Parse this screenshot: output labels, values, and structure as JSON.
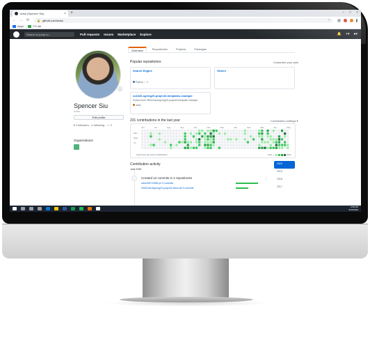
{
  "browser": {
    "tab_title": "sclss (Spencer Siu)",
    "tab_close": "×",
    "new_tab": "+",
    "window_controls": [
      "–",
      "□",
      "×"
    ],
    "nav": [
      "←",
      "→",
      "⟳"
    ],
    "url": "github.com/sclss",
    "bookmarks": [
      "Apps",
      "CS lab"
    ],
    "ext_colors": [
      "#9aa0a6",
      "#d93025",
      "#e8710a",
      "#5f6368"
    ]
  },
  "github_header": {
    "search_placeholder": "Search or jump to...",
    "nav": [
      "Pull requests",
      "Issues",
      "Marketplace",
      "Explore"
    ],
    "right_icons": [
      "bell-icon",
      "plus-icon",
      "avatar-icon"
    ]
  },
  "profile": {
    "full_name": "Spencer Siu",
    "username": "sclss",
    "edit_button": "Edit profile",
    "follow_stats": "ℹ 3 followers · 4 following · ☆ 3",
    "organizations_heading": "Organizations"
  },
  "tabs": [
    "Overview",
    "Repositories",
    "Projects",
    "Packages"
  ],
  "popular": {
    "heading": "Popular repositories",
    "customize": "Customize your pins",
    "repos": [
      {
        "name": "Search Engine",
        "description": "",
        "meta": "Python  ☆ 1",
        "lang_color": "#3572A5"
      },
      {
        "name": "Others",
        "description": "",
        "meta": "",
        "lang_color": ""
      },
      {
        "name": "cs1026-spring20-project3-templates-example",
        "description": "Forked from VBSChard/spring20-project3-template example",
        "meta": "Java",
        "lang_color": "#b07219"
      }
    ]
  },
  "contributions": {
    "heading": "231 contributions in the last year",
    "settings": "Contribution settings ▾",
    "months": [
      "Jun",
      "Jul",
      "Aug",
      "Sep",
      "Oct",
      "Nov",
      "Dec",
      "Jan",
      "Feb",
      "Mar",
      "Apr",
      "May"
    ],
    "days": [
      "Mon",
      "Wed",
      "Fri"
    ],
    "learn": "Learn how we count contributions",
    "legend_less": "Less",
    "legend_more": "More",
    "palette": [
      "#ebedf0",
      "#9be9a8",
      "#40c463",
      "#30a14e",
      "#216e39"
    ]
  },
  "activity": {
    "heading": "Contribution activity",
    "month": "June 2020",
    "title": "Created 12 commits in 2 repositories",
    "repo1": "sclss/EECS485-p4  9 commits",
    "repo2": "VBSChard/spring20-project3-team-aft  3 commits",
    "kebab": "⋮"
  },
  "years": [
    "2020",
    "2019",
    "2018",
    "2017"
  ],
  "taskbar": {
    "icon_colors": [
      "#ffffff",
      "#9aa0a6",
      "#9aa0a6",
      "#9aa0a6",
      "#0078d7",
      "#f2c811",
      "#2b579a",
      "#0f9d58",
      "#1db954",
      "#e8710a",
      "#ffffff"
    ],
    "time": "2:59 PM",
    "date": "6/23/2020"
  }
}
